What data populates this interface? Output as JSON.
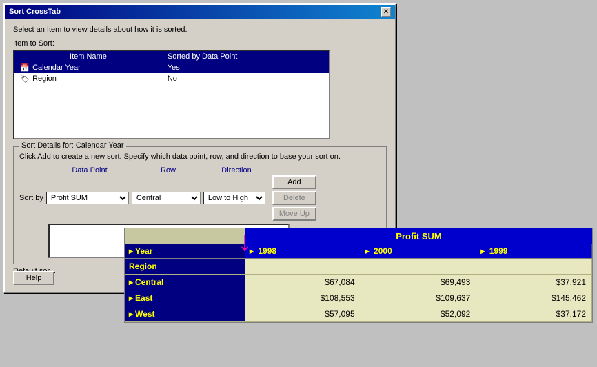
{
  "dialog": {
    "title": "Sort CrossTab",
    "close_label": "✕",
    "instruction": "Select an Item to view details about how it is sorted.",
    "item_to_sort_label": "Item to Sort:",
    "table": {
      "headers": [
        "Item Name",
        "Sorted by Data Point"
      ],
      "rows": [
        {
          "icon": "calendar",
          "name": "Calendar Year",
          "sorted": "Yes",
          "selected": true
        },
        {
          "icon": "region",
          "name": "Region",
          "sorted": "No",
          "selected": false
        }
      ]
    },
    "sort_details": {
      "legend": "Sort Details for: Calendar Year",
      "description": "Click Add to create a new sort. Specify which data point, row, and direction to base your sort on.",
      "col_headers": [
        "Data Point",
        "Row",
        "Direction"
      ],
      "sort_by_label": "Sort by",
      "sort_row": {
        "data_point": "Profit SUM",
        "row": "Central",
        "direction": "Low to High"
      },
      "buttons": {
        "add": "Add",
        "delete": "Delete",
        "move_up": "Move Up"
      }
    },
    "default_sort_label": "Default sor...",
    "footer_buttons": [
      "Help"
    ]
  },
  "crosstab": {
    "title": "Profit SUM",
    "row_label": "Year",
    "col_headers": [
      "1998",
      "2000",
      "1999"
    ],
    "row_header_label": "Region",
    "rows": [
      {
        "label": "Central",
        "values": [
          "$67,084",
          "$69,493",
          "$37,921"
        ]
      },
      {
        "label": "East",
        "values": [
          "$108,553",
          "$109,637",
          "$145,462"
        ]
      },
      {
        "label": "West",
        "values": [
          "$57,095",
          "$52,092",
          "$37,172"
        ]
      }
    ]
  },
  "colors": {
    "dialog_bg": "#d4d0c8",
    "title_bar_start": "#000080",
    "table_header_bg": "#000080",
    "selected_row_bg": "#000080",
    "crosstab_header_bg": "#0000cc",
    "crosstab_data_bg": "#e8e8c0",
    "crosstab_row_header_bg": "#000080",
    "crosstab_corner_bg": "#c8c8a0",
    "yellow_text": "#ffff00",
    "pink_arrow": "#ff00aa"
  }
}
